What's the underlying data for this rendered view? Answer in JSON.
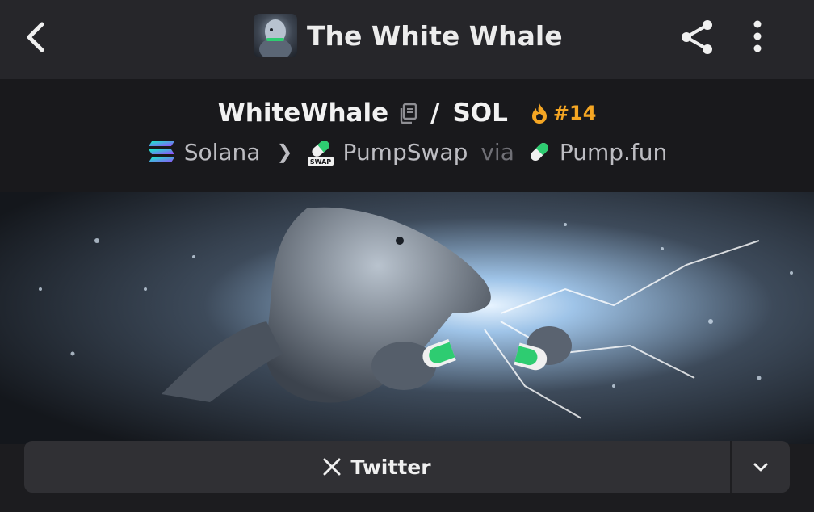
{
  "header": {
    "title": "The White Whale",
    "back_icon": "chevron-left-icon",
    "share_icon": "share-icon",
    "more_icon": "more-vertical-icon"
  },
  "pair": {
    "token": "WhiteWhale",
    "separator": "/",
    "quote": "SOL",
    "rank": "#14",
    "rank_color": "#f5a623"
  },
  "chain": {
    "network": "Solana",
    "dex": "PumpSwap",
    "dex_badge": "SWAP",
    "via": "via",
    "launchpad": "Pump.fun"
  },
  "links": {
    "twitter_label": "Twitter"
  },
  "colors": {
    "background": "#1c1c1f",
    "topbar": "#26262a",
    "accent_green": "#2ecc71"
  }
}
